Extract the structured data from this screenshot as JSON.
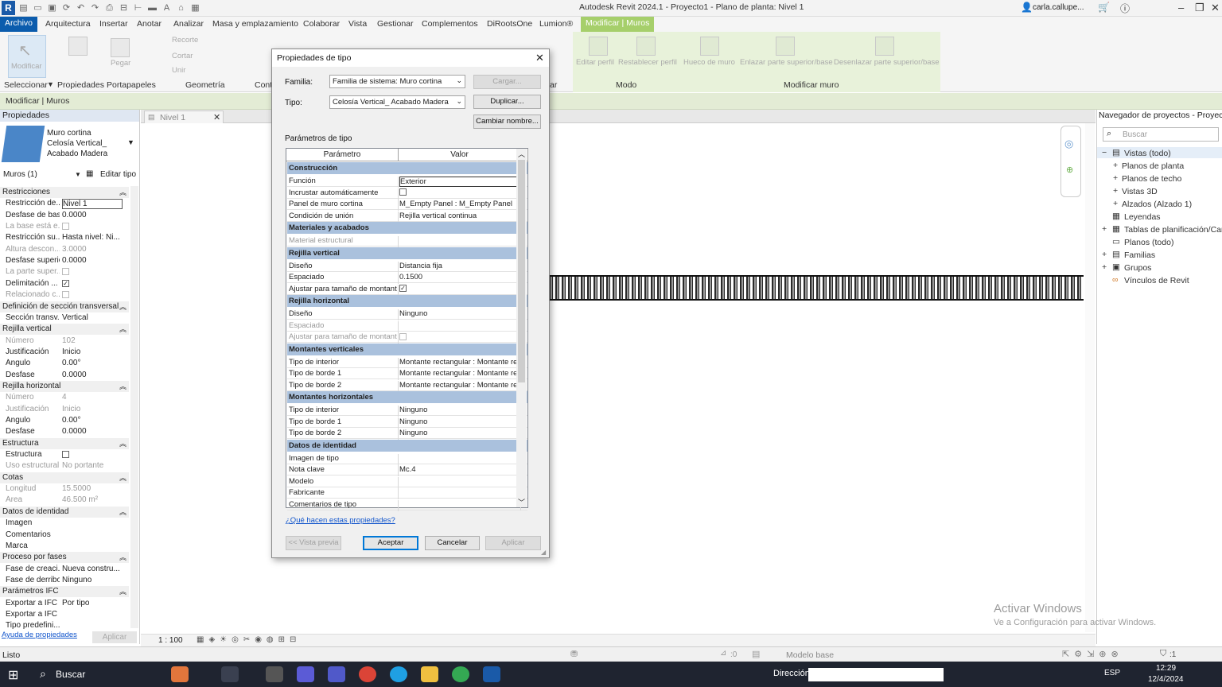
{
  "window": {
    "title": "Autodesk Revit 2024.1 - Proyecto1 - Plano de planta: Nivel 1",
    "user": "carla.callupe..."
  },
  "menu": [
    "Archivo",
    "Arquitectura",
    "Insertar",
    "Anotar",
    "Analizar",
    "Masa y emplazamiento",
    "Colaborar",
    "Vista",
    "Gestionar",
    "Complementos",
    "DiRootsOne",
    "Lumion®",
    "Modificar | Muros"
  ],
  "ribbon": {
    "modificar": "Modificar",
    "pegar": "Pegar",
    "recorte": "Recorte",
    "cortar": "Cortar",
    "unir": "Unir",
    "panels": {
      "seleccionar": "Seleccionar",
      "propiedades": "Propiedades",
      "portapapeles": "Portapapeles",
      "geometria": "Geometría",
      "cont": "Cont",
      "modo": "Modo",
      "modificar_muro": "Modificar muro"
    },
    "green": {
      "editar_perfil": "Editar perfil",
      "restablecer_perfil": "Restablecer perfil",
      "hueco_muro": "Hueco de muro",
      "enlazar": "Enlazar parte superior/base",
      "desenlazar": "Desenlazar parte superior/base",
      "ar": "ar"
    }
  },
  "context_bar": "Modificar | Muros",
  "properties": {
    "header": "Propiedades",
    "type_line1": "Muro cortina",
    "type_line2": "Celosía Vertical_",
    "type_line3": "Acabado Madera",
    "selector": "Muros (1)",
    "edit_type": "Editar tipo",
    "rows": [
      {
        "t": "sec",
        "k": "Restricciones"
      },
      {
        "k": "Restricción de...",
        "v": "Nivel 1"
      },
      {
        "k": "Desfase de base",
        "v": "0.0000"
      },
      {
        "k": "La base está e...",
        "v": "",
        "g": 1,
        "cb": 1
      },
      {
        "k": "Restricción su...",
        "v": "Hasta nivel: Ni..."
      },
      {
        "k": "Altura descon...",
        "v": "3.0000",
        "g": 1
      },
      {
        "k": "Desfase superior",
        "v": "0.0000"
      },
      {
        "k": "La parte super...",
        "v": "",
        "g": 1,
        "cb": 1
      },
      {
        "k": "Delimitación ...",
        "v": "",
        "cb": 2
      },
      {
        "k": "Relacionado c...",
        "v": "",
        "g": 1,
        "cb": 1
      },
      {
        "t": "sec",
        "k": "Definición de sección transversal"
      },
      {
        "k": "Sección transv...",
        "v": "Vertical"
      },
      {
        "t": "sec",
        "k": "Rejilla vertical"
      },
      {
        "k": "Número",
        "v": "102",
        "g": 1
      },
      {
        "k": "Justificación",
        "v": "Inicio"
      },
      {
        "k": "Ángulo",
        "v": "0.00°"
      },
      {
        "k": "Desfase",
        "v": "0.0000"
      },
      {
        "t": "sec",
        "k": "Rejilla horizontal"
      },
      {
        "k": "Número",
        "v": "4",
        "g": 1
      },
      {
        "k": "Justificación",
        "v": "Inicio",
        "g": 1
      },
      {
        "k": "Ángulo",
        "v": "0.00°"
      },
      {
        "k": "Desfase",
        "v": "0.0000"
      },
      {
        "t": "sec",
        "k": "Estructura"
      },
      {
        "k": "Estructura",
        "v": "",
        "cb": 1
      },
      {
        "k": "Uso estructural",
        "v": "No portante",
        "g": 1
      },
      {
        "t": "sec",
        "k": "Cotas"
      },
      {
        "k": "Longitud",
        "v": "15.5000",
        "g": 1
      },
      {
        "k": "Área",
        "v": "46.500 m²",
        "g": 1
      },
      {
        "t": "sec",
        "k": "Datos de identidad"
      },
      {
        "k": "Imagen",
        "v": ""
      },
      {
        "k": "Comentarios",
        "v": ""
      },
      {
        "k": "Marca",
        "v": ""
      },
      {
        "t": "sec",
        "k": "Proceso por fases"
      },
      {
        "k": "Fase de creaci...",
        "v": "Nueva constru..."
      },
      {
        "k": "Fase de derribo",
        "v": "Ninguno"
      },
      {
        "t": "sec",
        "k": "Parámetros IFC"
      },
      {
        "k": "Exportar a IFC",
        "v": "Por tipo"
      },
      {
        "k": "Exportar a IFC ...",
        "v": ""
      },
      {
        "k": "Tipo predefini...",
        "v": ""
      }
    ],
    "help_link": "Ayuda de propiedades",
    "apply": "Aplicar"
  },
  "view_tab": "Nivel 1",
  "scale": "1 : 100",
  "navigator": {
    "title": "Navegador de proyectos - Proyect...",
    "search_placeholder": "Buscar",
    "items": [
      "Vistas (todo)",
      "Planos de planta",
      "Planos de techo",
      "Vistas 3D",
      "Alzados (Alzado 1)",
      "Leyendas",
      "Tablas de planificación/Cantid...",
      "Planos (todo)",
      "Familias",
      "Grupos",
      "Vínculos de Revit"
    ]
  },
  "dialog": {
    "title": "Propiedades de tipo",
    "familia_label": "Familia:",
    "familia_value": "Familia de sistema: Muro cortina",
    "tipo_label": "Tipo:",
    "tipo_value": "Celosía Vertical_ Acabado Madera",
    "cargar": "Cargar...",
    "duplicar": "Duplicar...",
    "cambiar": "Cambiar nombre...",
    "params_label": "Parámetros de tipo",
    "col_param": "Parámetro",
    "col_valor": "Valor",
    "rows": [
      {
        "t": "sec",
        "k": "Construcción"
      },
      {
        "k": "Función",
        "v": "Exterior",
        "edit": 1
      },
      {
        "k": "Incrustar automáticamente",
        "v": "",
        "cb": 1
      },
      {
        "k": "Panel de muro cortina",
        "v": "M_Empty Panel : M_Empty Panel"
      },
      {
        "k": "Condición de unión",
        "v": "Rejilla vertical continua"
      },
      {
        "t": "sec",
        "k": "Materiales y acabados"
      },
      {
        "k": "Material estructural",
        "v": "",
        "g": 1
      },
      {
        "t": "sec",
        "k": "Rejilla vertical"
      },
      {
        "k": "Diseño",
        "v": "Distancia fija"
      },
      {
        "k": "Espaciado",
        "v": "0.1500"
      },
      {
        "k": "Ajustar para tamaño de montant",
        "v": "",
        "cb": 2
      },
      {
        "t": "sec",
        "k": "Rejilla horizontal"
      },
      {
        "k": "Diseño",
        "v": "Ninguno"
      },
      {
        "k": "Espaciado",
        "v": "",
        "g": 1
      },
      {
        "k": "Ajustar para tamaño de montant",
        "v": "",
        "g": 1,
        "cb": 1
      },
      {
        "t": "sec",
        "k": "Montantes verticales"
      },
      {
        "k": "Tipo de interior",
        "v": "Montante rectangular : Montante re"
      },
      {
        "k": "Tipo de borde 1",
        "v": "Montante rectangular : Montante re"
      },
      {
        "k": "Tipo de borde 2",
        "v": "Montante rectangular : Montante re"
      },
      {
        "t": "sec",
        "k": "Montantes horizontales"
      },
      {
        "k": "Tipo de interior",
        "v": "Ninguno"
      },
      {
        "k": "Tipo de borde 1",
        "v": "Ninguno"
      },
      {
        "k": "Tipo de borde 2",
        "v": "Ninguno"
      },
      {
        "t": "sec",
        "k": "Datos de identidad"
      },
      {
        "k": "Imagen de tipo",
        "v": ""
      },
      {
        "k": "Nota clave",
        "v": "Mc.4"
      },
      {
        "k": "Modelo",
        "v": ""
      },
      {
        "k": "Fabricante",
        "v": ""
      },
      {
        "k": "Comentarios de tipo",
        "v": ""
      }
    ],
    "help_link": "¿Qué hacen estas propiedades?",
    "preview": "<< Vista previa",
    "ok": "Aceptar",
    "cancel": "Cancelar",
    "apply": "Aplicar"
  },
  "status": {
    "left": "Listo",
    "model": "Modelo base",
    "filter": ":1",
    "coord": ":0"
  },
  "watermark": {
    "line1": "Activar Windows",
    "line2": "Ve a Configuración para activar Windows."
  },
  "taskbar": {
    "search": "Buscar",
    "direccion": "Dirección",
    "lang": "ESP",
    "time": "12:29",
    "date": "12/4/2024"
  }
}
